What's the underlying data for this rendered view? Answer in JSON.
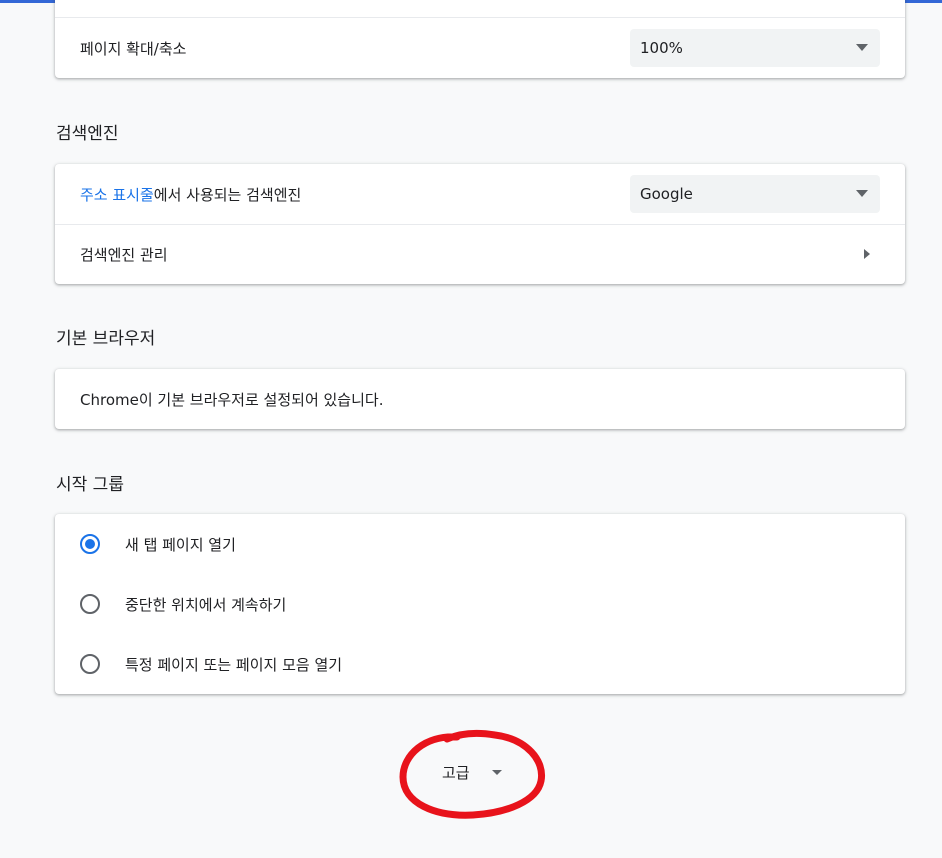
{
  "appearance": {
    "zoom_label": "페이지 확대/축소",
    "zoom_value": "100%"
  },
  "search_engine": {
    "section_title": "검색엔진",
    "address_bar_link": "주소 표시줄",
    "address_bar_suffix": "에서 사용되는 검색엔진",
    "selected_engine": "Google",
    "manage_label": "검색엔진 관리"
  },
  "default_browser": {
    "section_title": "기본 브라우저",
    "status_text": "Chrome이 기본 브라우저로 설정되어 있습니다."
  },
  "on_startup": {
    "section_title": "시작 그룹",
    "options": [
      {
        "label": "새 탭 페이지 열기",
        "checked": true
      },
      {
        "label": "중단한 위치에서 계속하기",
        "checked": false
      },
      {
        "label": "특정 페이지 또는 페이지 모음 열기",
        "checked": false
      }
    ]
  },
  "advanced": {
    "label": "고급"
  },
  "colors": {
    "accent": "#1a73e8",
    "top_bar": "#3367d6",
    "annotation": "#e8131b"
  }
}
